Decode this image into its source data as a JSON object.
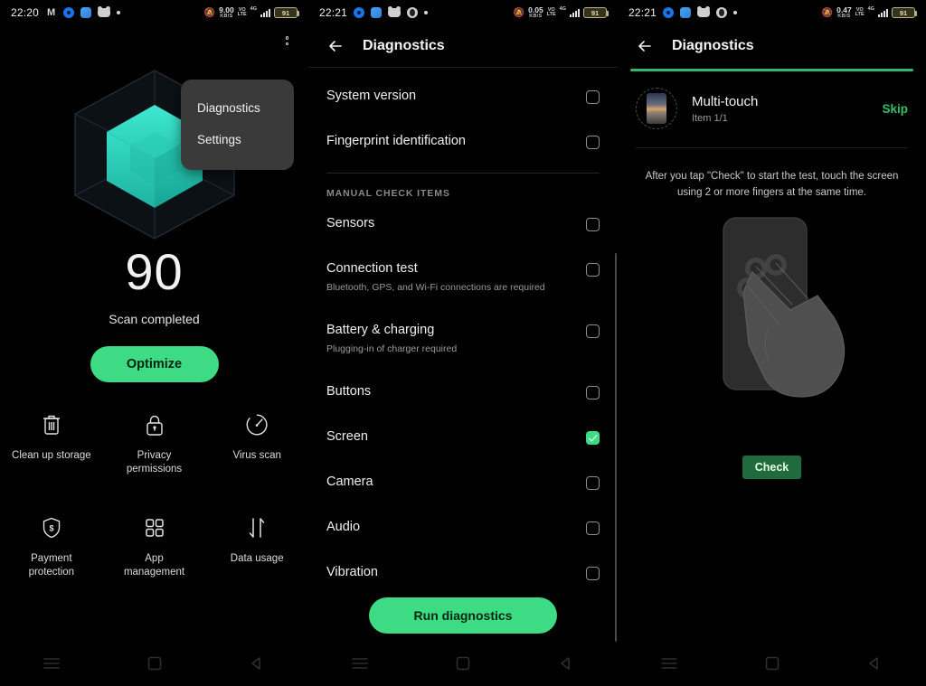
{
  "panels": [
    {
      "status": {
        "time": "22:20",
        "icons": [
          "gmail-icon",
          "gear-icon",
          "app-icon",
          "game-icon",
          "dot-icon"
        ],
        "net_speed_value": "9.00",
        "net_speed_unit": "KB/S",
        "sim_label_top": "VO",
        "sim_label_bottom": "LTE",
        "network_tag": "4G",
        "battery": "91"
      },
      "menu": {
        "kebab": "overflow-menu",
        "items": [
          "Diagnostics",
          "Settings"
        ]
      },
      "score": "90",
      "score_label": "Scan completed",
      "optimize_label": "Optimize",
      "tiles": [
        {
          "icon": "trash-icon",
          "label": "Clean up storage"
        },
        {
          "icon": "lock-icon",
          "label": "Privacy\npermissions"
        },
        {
          "icon": "gauge-icon",
          "label": "Virus scan"
        },
        {
          "icon": "shield-dollar-icon",
          "label": "Payment\nprotection"
        },
        {
          "icon": "grid-icon",
          "label": "App\nmanagement"
        },
        {
          "icon": "arrows-icon",
          "label": "Data usage"
        }
      ]
    },
    {
      "status": {
        "time": "22:21",
        "net_speed_value": "0.05",
        "net_speed_unit": "KB/S",
        "battery": "91"
      },
      "title": "Diagnostics",
      "top_items": [
        {
          "label": "System version",
          "checked": false
        },
        {
          "label": "Fingerprint identification",
          "checked": false
        }
      ],
      "section_header": "MANUAL CHECK ITEMS",
      "manual_items": [
        {
          "label": "Sensors",
          "sub": "",
          "checked": false
        },
        {
          "label": "Connection test",
          "sub": "Bluetooth, GPS, and Wi-Fi connections are required",
          "checked": false
        },
        {
          "label": "Battery & charging",
          "sub": "Plugging-in of charger required",
          "checked": false
        },
        {
          "label": "Buttons",
          "sub": "",
          "checked": false
        },
        {
          "label": "Screen",
          "sub": "",
          "checked": true
        },
        {
          "label": "Camera",
          "sub": "",
          "checked": false
        },
        {
          "label": "Audio",
          "sub": "",
          "checked": false
        },
        {
          "label": "Vibration",
          "sub": "",
          "checked": false
        }
      ],
      "run_label": "Run diagnostics"
    },
    {
      "status": {
        "time": "22:21",
        "net_speed_value": "0.47",
        "net_speed_unit": "KB/S",
        "battery": "91"
      },
      "title": "Diagnostics",
      "test_name": "Multi-touch",
      "test_progress": "Item 1/1",
      "skip_label": "Skip",
      "instruction": "After you tap \"Check\" to start the test, touch the screen using 2 or more fingers at the same time.",
      "check_label": "Check"
    }
  ],
  "navbar": {
    "menu": "menu-icon",
    "home": "home-icon",
    "back": "back-icon"
  },
  "colors": {
    "accent_green": "#3ddc84",
    "skip_green": "#2fc06b",
    "cube_teal": "#2ed9c3",
    "check_green": "#1f6b3e"
  }
}
